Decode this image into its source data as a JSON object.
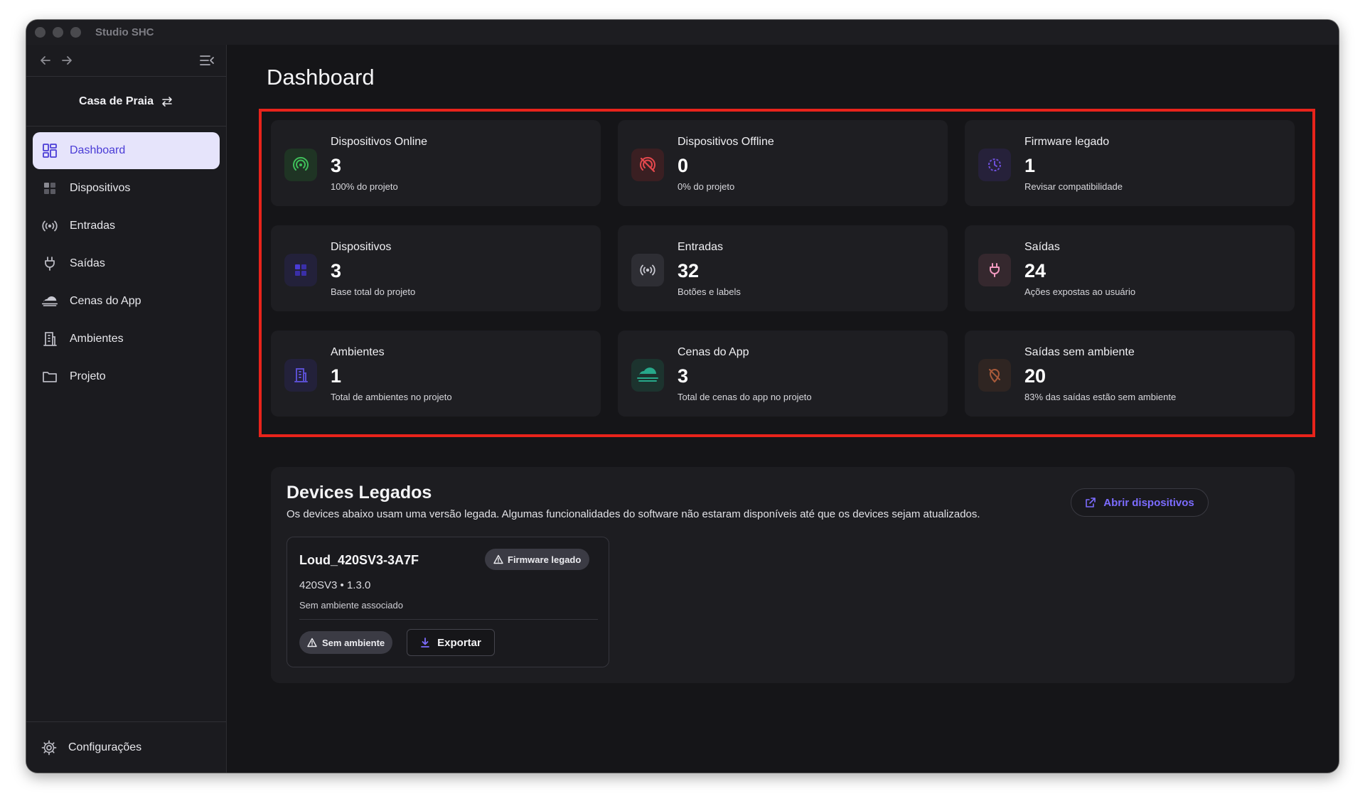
{
  "window": {
    "title": "Studio SHC"
  },
  "sidebar": {
    "project_name": "Casa de Praia",
    "items": [
      {
        "label": "Dashboard",
        "icon": "dashboard-icon",
        "active": true
      },
      {
        "label": "Dispositivos",
        "icon": "devices-icon",
        "active": false
      },
      {
        "label": "Entradas",
        "icon": "broadcast-icon",
        "active": false
      },
      {
        "label": "Saídas",
        "icon": "plug-icon",
        "active": false
      },
      {
        "label": "Cenas do App",
        "icon": "cloud-icon",
        "active": false
      },
      {
        "label": "Ambientes",
        "icon": "building-icon",
        "active": false
      },
      {
        "label": "Projeto",
        "icon": "folder-icon",
        "active": false
      }
    ],
    "settings_label": "Configurações"
  },
  "main": {
    "title": "Dashboard",
    "cards": [
      {
        "label": "Dispositivos Online",
        "value": "3",
        "sub": "100% do projeto",
        "icon": "online-icon",
        "color": "#3fbf5a"
      },
      {
        "label": "Dispositivos Offline",
        "value": "0",
        "sub": "0% do projeto",
        "icon": "offline-icon",
        "color": "#e5484d"
      },
      {
        "label": "Firmware legado",
        "value": "1",
        "sub": "Revisar compatibilidade",
        "icon": "history-icon",
        "color": "#6d4fd8"
      },
      {
        "label": "Dispositivos",
        "value": "3",
        "sub": "Base total do projeto",
        "icon": "devices-icon",
        "color": "#4a3cd6"
      },
      {
        "label": "Entradas",
        "value": "32",
        "sub": "Botões e labels",
        "icon": "broadcast-icon",
        "color": "#c8c8d0"
      },
      {
        "label": "Saídas",
        "value": "24",
        "sub": "Ações expostas ao usuário",
        "icon": "plug-icon",
        "color": "#f29ac0"
      },
      {
        "label": "Ambientes",
        "value": "1",
        "sub": "Total de ambientes no projeto",
        "icon": "building-icon",
        "color": "#5a4fd0"
      },
      {
        "label": "Cenas do App",
        "value": "3",
        "sub": "Total de cenas do app no projeto",
        "icon": "cloud-icon",
        "color": "#27a88a"
      },
      {
        "label": "Saídas sem ambiente",
        "value": "20",
        "sub": "83% das saídas estão sem ambiente",
        "icon": "no-location-icon",
        "color": "#a85a3a"
      }
    ]
  },
  "legacy": {
    "title": "Devices Legados",
    "description": "Os devices abaixo usam uma versão legada. Algumas funcionalidades do software não estaram disponíveis até que os devices sejam atualizados.",
    "open_button": "Abrir dispositivos",
    "device": {
      "name": "Loud_420SV3-3A7F",
      "badge": "Firmware legado",
      "meta": "420SV3 • 1.3.0",
      "environment": "Sem ambiente associado",
      "chip": "Sem ambiente",
      "export_button": "Exportar"
    }
  }
}
